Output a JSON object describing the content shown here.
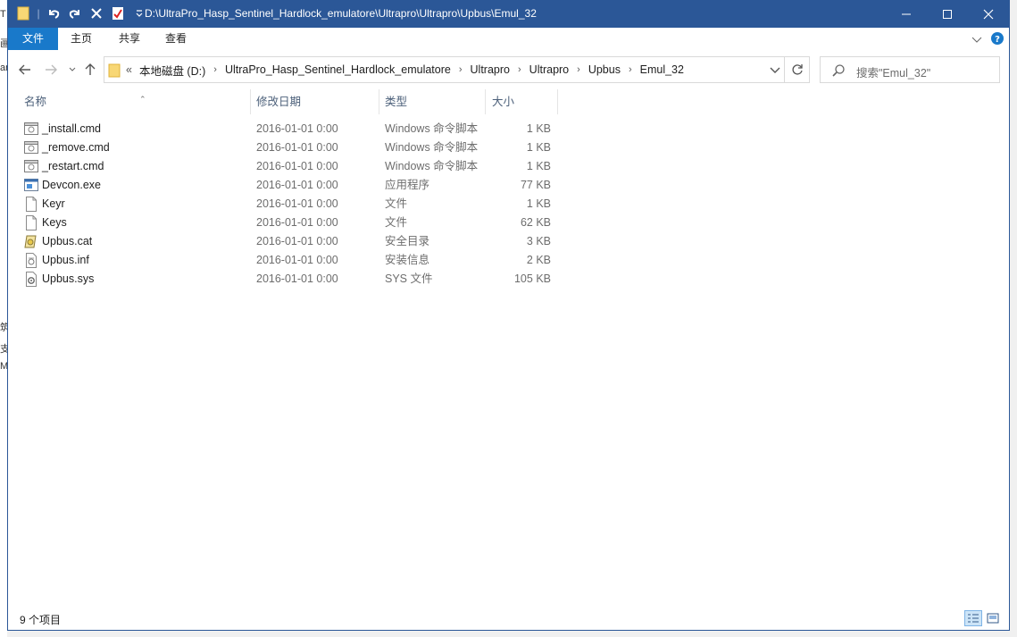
{
  "window": {
    "title": "D:\\UltraPro_Hasp_Sentinel_Hardlock_emulatore\\Ultrapro\\Ultrapro\\Upbus\\Emul_32",
    "titlebar_color": "#2b5797"
  },
  "ribbon": {
    "file_tab": "文件",
    "home_tab": "主页",
    "share_tab": "共享",
    "view_tab": "查看",
    "accent": "#1979ca"
  },
  "address": {
    "overflow": "«",
    "crumbs": [
      "本地磁盘 (D:)",
      "UltraPro_Hasp_Sentinel_Hardlock_emulatore",
      "Ultrapro",
      "Ultrapro",
      "Upbus",
      "Emul_32"
    ]
  },
  "search": {
    "placeholder": "搜索\"Emul_32\""
  },
  "columns": {
    "name": "名称",
    "date": "修改日期",
    "type": "类型",
    "size": "大小"
  },
  "files": [
    {
      "name": "_install.cmd",
      "date": "2016-01-01 0:00",
      "type": "Windows 命令脚本",
      "size": "1 KB",
      "icon": "cmd-icon"
    },
    {
      "name": "_remove.cmd",
      "date": "2016-01-01 0:00",
      "type": "Windows 命令脚本",
      "size": "1 KB",
      "icon": "cmd-icon"
    },
    {
      "name": "_restart.cmd",
      "date": "2016-01-01 0:00",
      "type": "Windows 命令脚本",
      "size": "1 KB",
      "icon": "cmd-icon"
    },
    {
      "name": "Devcon.exe",
      "date": "2016-01-01 0:00",
      "type": "应用程序",
      "size": "77 KB",
      "icon": "exe-icon"
    },
    {
      "name": "Keyr",
      "date": "2016-01-01 0:00",
      "type": "文件",
      "size": "1 KB",
      "icon": "file-icon"
    },
    {
      "name": "Keys",
      "date": "2016-01-01 0:00",
      "type": "文件",
      "size": "62 KB",
      "icon": "file-icon"
    },
    {
      "name": "Upbus.cat",
      "date": "2016-01-01 0:00",
      "type": "安全目录",
      "size": "3 KB",
      "icon": "cat-icon"
    },
    {
      "name": "Upbus.inf",
      "date": "2016-01-01 0:00",
      "type": "安装信息",
      "size": "2 KB",
      "icon": "inf-icon"
    },
    {
      "name": "Upbus.sys",
      "date": "2016-01-01 0:00",
      "type": "SYS 文件",
      "size": "105 KB",
      "icon": "sys-icon"
    }
  ],
  "status": {
    "count": "9 个项目"
  }
}
